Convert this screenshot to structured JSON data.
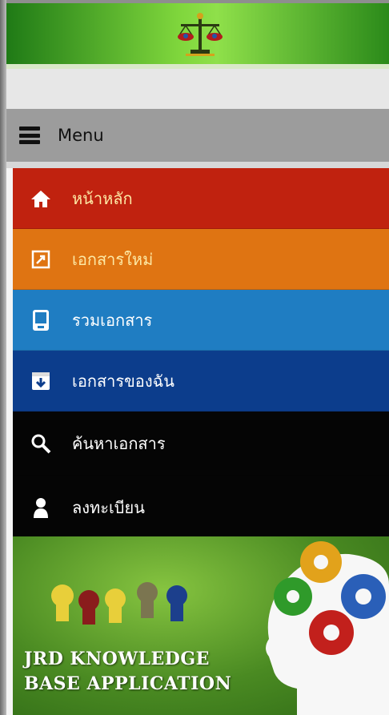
{
  "app": {
    "menu_label": "Menu"
  },
  "menu": {
    "items": [
      {
        "label": "หน้าหลัก",
        "icon": "home-icon",
        "color": "#c0220f"
      },
      {
        "label": "เอกสารใหม่",
        "icon": "new-document-icon",
        "color": "#df7412"
      },
      {
        "label": "รวมเอกสาร",
        "icon": "documents-icon",
        "color": "#1f7dc2"
      },
      {
        "label": "เอกสารของฉัน",
        "icon": "download-box-icon",
        "color": "#0c3d8c"
      },
      {
        "label": "ค้นหาเอกสาร",
        "icon": "search-icon",
        "color": "#050505"
      },
      {
        "label": "ลงทะเบียน",
        "icon": "person-icon",
        "color": "#050505"
      }
    ]
  },
  "banner": {
    "line1": "JRD KNOWLEDGE",
    "line2": "BASE APPLICATION"
  },
  "colors": {
    "header_green": "#7fd63c",
    "menubar_gray": "#9c9c9c"
  }
}
